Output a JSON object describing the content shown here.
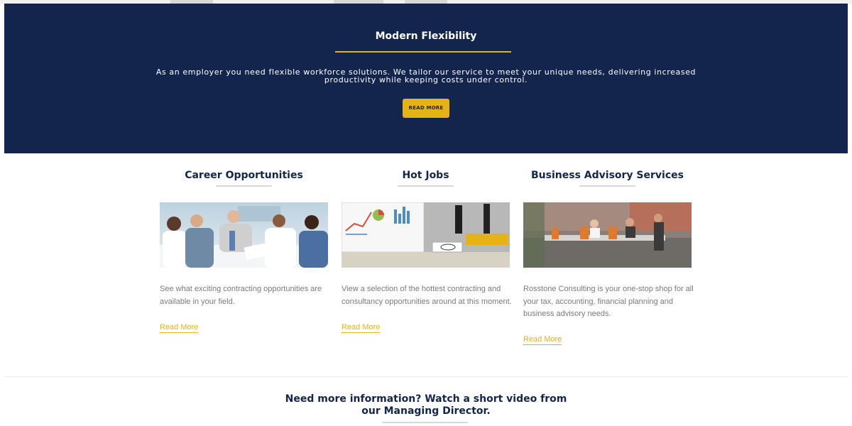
{
  "hero": {
    "title": "Modern Flexibility",
    "text": "As an employer you need flexible workforce solutions. We tailor our service to meet your unique needs, delivering increased productivity while keeping costs under control.",
    "button_label": "READ MORE"
  },
  "columns": [
    {
      "title": "Career Opportunities",
      "image": "team-meeting-photo",
      "text": "See what exciting contracting opportunities are available in your field.",
      "link_label": "Read More"
    },
    {
      "title": "Hot Jobs",
      "image": "charts-on-monitor-photo",
      "text": "View a selection of the hottest contracting and consultancy opportunities around at this moment.",
      "link_label": "Read More"
    },
    {
      "title": "Business Advisory Services",
      "image": "boardroom-photo",
      "text": "Rosstone Consulting is your one-stop shop for all your tax, accounting, financial planning and business advisory needs.",
      "link_label": "Read More"
    }
  ],
  "video_section": {
    "title": "Need more information? Watch a short video from our Managing Director."
  },
  "colors": {
    "navy": "#13244d",
    "gold": "#e5b316",
    "body_text": "#7a7a7a",
    "rule_grey": "#d9d9d9"
  }
}
